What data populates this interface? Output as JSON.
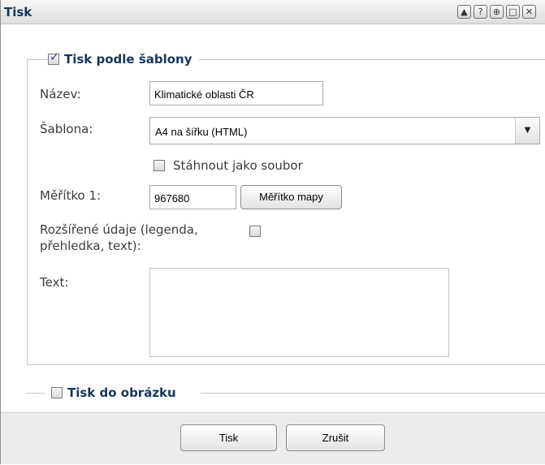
{
  "window": {
    "title": "Tisk",
    "buttons": [
      {
        "icon": "collapse-icon",
        "glyph": "▲"
      },
      {
        "icon": "help-icon",
        "glyph": "?"
      },
      {
        "icon": "pin-icon",
        "glyph": "⊕"
      },
      {
        "icon": "maximize-icon",
        "glyph": "□"
      },
      {
        "icon": "close-icon",
        "glyph": "✕"
      }
    ]
  },
  "template_print": {
    "legend": "Tisk podle šablony",
    "checked": true,
    "name_label": "Název:",
    "name_value": "Klimatické oblasti ČR",
    "template_label": "Šablona:",
    "template_value": "A4 na šířku (HTML)",
    "download_label": "Stáhnout jako soubor",
    "scale_label": "Měřítko 1:",
    "scale_value": "967680",
    "scale_button": "Měřítko mapy",
    "extended_label_line1": "Rozšířené údaje (legenda,",
    "extended_label_line2": "přehledka, text):",
    "text_label": "Text:",
    "text_value": ""
  },
  "image_print": {
    "legend": "Tisk do obrázku",
    "checked": false
  },
  "footer": {
    "print_button": "Tisk",
    "cancel_button": "Zrušit"
  }
}
